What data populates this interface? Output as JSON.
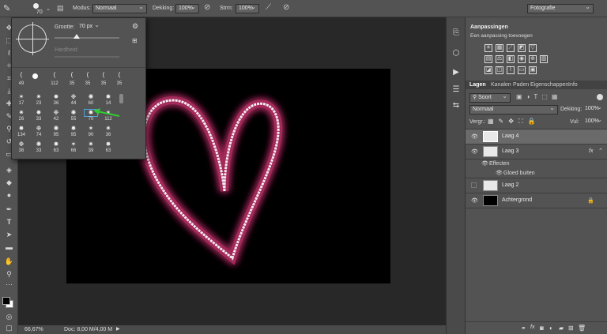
{
  "options_bar": {
    "brush_size": "70",
    "mode_label": "Modus:",
    "mode_value": "Normaal",
    "opacity_label": "Dekking:",
    "opacity_value": "100%",
    "flow_label": "Strm:",
    "flow_value": "100%",
    "workspace": "Fotografie"
  },
  "brush_picker": {
    "size_label": "Grootte:",
    "size_value": "70 px",
    "hardness_label": "Hardheid:",
    "row1_sizes": [
      "49",
      "",
      "112",
      "35",
      "35",
      "35",
      "35"
    ],
    "grid_sizes": [
      [
        "17",
        "23",
        "36",
        "44",
        "60",
        "14"
      ],
      [
        "26",
        "33",
        "42",
        "55",
        "70",
        "112"
      ],
      [
        "134",
        "74",
        "95",
        "95",
        "90",
        "36"
      ],
      [
        "36",
        "33",
        "63",
        "66",
        "39",
        "63"
      ]
    ],
    "selected_size": "70"
  },
  "status": {
    "zoom": "66,67%",
    "doc": "Doc: 8,00 M/4,00 M"
  },
  "adjustments": {
    "title": "Aanpassingen",
    "subtitle": "Een aanpassing toevoegen"
  },
  "layers_panel": {
    "tabs": [
      "Lagen",
      "Kanalen",
      "Paden",
      "Eigenschappen",
      "Info"
    ],
    "filter_label": "Soort",
    "blend_mode": "Normaal",
    "opacity_label": "Dekking:",
    "opacity_value": "100%",
    "lock_label": "Vergr.:",
    "fill_label": "Vul:",
    "fill_value": "100%",
    "layers": [
      {
        "name": "Laag 4"
      },
      {
        "name": "Laag 3"
      },
      {
        "name": "Effecten"
      },
      {
        "name": "Gloed buiten"
      },
      {
        "name": "Laag 2"
      },
      {
        "name": "Achtergrond"
      }
    ],
    "fx_label": "fx"
  },
  "colors": {
    "glow": "#c0306a",
    "arrow": "#33cc33",
    "selected_layer": "#6a6a6a"
  }
}
